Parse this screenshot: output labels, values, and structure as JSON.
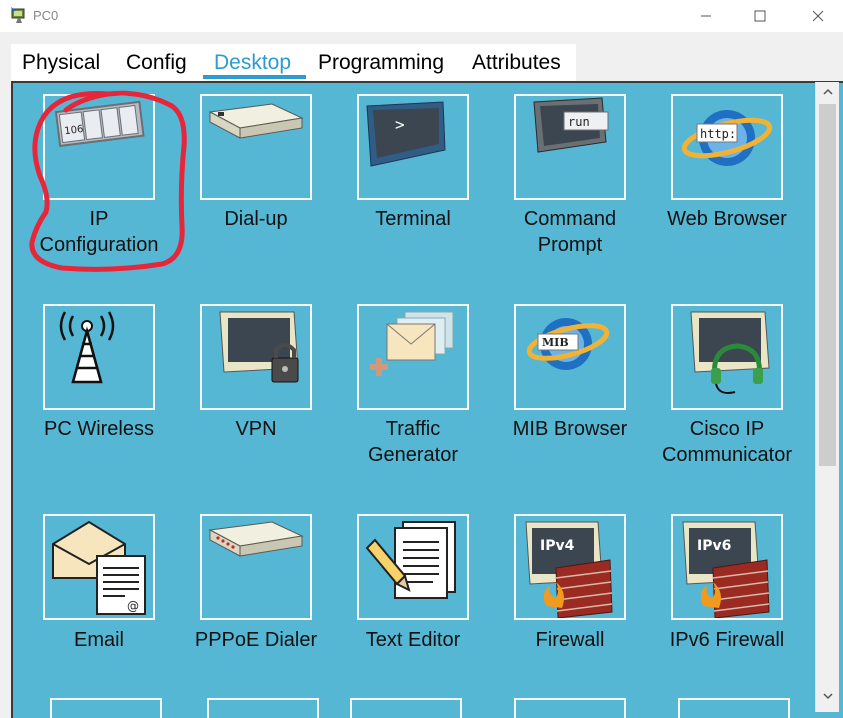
{
  "window": {
    "title": "PC0",
    "minimize_icon": "minimize-icon",
    "maximize_icon": "maximize-icon",
    "close_icon": "close-icon"
  },
  "tabs": [
    {
      "label": "Physical",
      "active": false
    },
    {
      "label": "Config",
      "active": false
    },
    {
      "label": "Desktop",
      "active": true
    },
    {
      "label": "Programming",
      "active": false
    },
    {
      "label": "Attributes",
      "active": false
    }
  ],
  "colors": {
    "desktop_background": "#56b7d4",
    "active_tab": "#2d9bd1",
    "annotation_circle": "#e8263a"
  },
  "desktop": {
    "apps": [
      {
        "label_line1": "IP",
        "label_line2": "Configuration",
        "icon": "ip-configuration-icon",
        "icon_text": "106",
        "highlighted": true
      },
      {
        "label_line1": "Dial-up",
        "label_line2": "",
        "icon": "modem-icon"
      },
      {
        "label_line1": "Terminal",
        "label_line2": "",
        "icon": "terminal-icon",
        "icon_text": ">"
      },
      {
        "label_line1": "Command",
        "label_line2": "Prompt",
        "icon": "command-prompt-icon",
        "icon_text": "run"
      },
      {
        "label_line1": "Web Browser",
        "label_line2": "",
        "icon": "web-browser-icon",
        "icon_text": "http:"
      },
      {
        "label_line1": "PC Wireless",
        "label_line2": "",
        "icon": "wireless-tower-icon"
      },
      {
        "label_line1": "VPN",
        "label_line2": "",
        "icon": "vpn-lock-monitor-icon"
      },
      {
        "label_line1": "Traffic",
        "label_line2": "Generator",
        "icon": "traffic-generator-icon"
      },
      {
        "label_line1": "MIB Browser",
        "label_line2": "",
        "icon": "mib-browser-icon",
        "icon_text": "MIB"
      },
      {
        "label_line1": "Cisco IP",
        "label_line2": "Communicator",
        "icon": "headset-monitor-icon"
      },
      {
        "label_line1": "Email",
        "label_line2": "",
        "icon": "email-icon",
        "icon_text": "@"
      },
      {
        "label_line1": "PPPoE Dialer",
        "label_line2": "",
        "icon": "pppoe-modem-icon"
      },
      {
        "label_line1": "Text Editor",
        "label_line2": "",
        "icon": "text-editor-icon"
      },
      {
        "label_line1": "Firewall",
        "label_line2": "",
        "icon": "firewall-icon",
        "icon_text": "IPv4"
      },
      {
        "label_line1": "IPv6 Firewall",
        "label_line2": "",
        "icon": "ipv6-firewall-icon",
        "icon_text": "IPv6"
      }
    ]
  },
  "scrollbar": {
    "up_icon": "scroll-up-arrow-icon",
    "down_icon": "scroll-down-arrow-icon"
  }
}
